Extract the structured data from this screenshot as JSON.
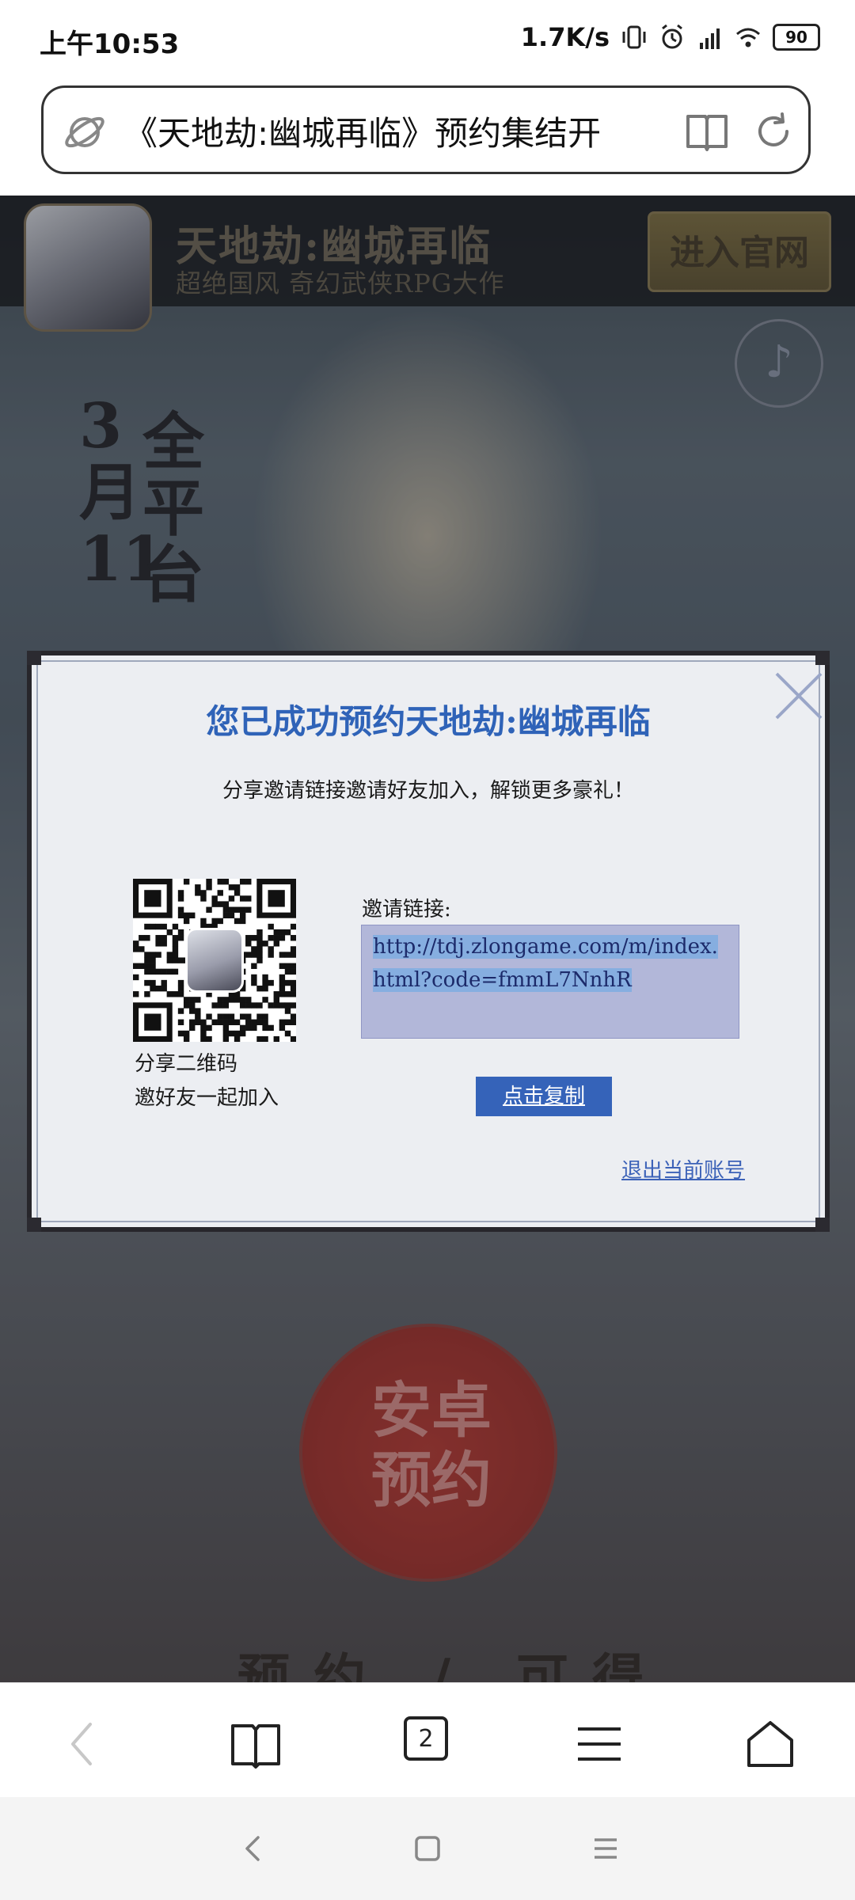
{
  "status_bar": {
    "time": "上午10:53",
    "network_speed": "1.7K/s",
    "battery": "90",
    "icons": [
      "vibrate-icon",
      "alarm-icon",
      "hd-signal-icon",
      "wifi-icon",
      "battery-icon"
    ]
  },
  "url_bar": {
    "text": "《天地劫:幽城再临》预约集结开",
    "icons": [
      "planet-icon",
      "reader-mode-icon",
      "reload-icon"
    ]
  },
  "page": {
    "banner": {
      "title": "天地劫:幽城再临",
      "subtitle": "超绝国风 奇幻武侠RPG大作",
      "enter_button": "进入官网"
    },
    "date_col1": "3月11",
    "date_col2": "全平台",
    "reserve_button": "安卓预约",
    "gift_text": "预约 / 可得"
  },
  "modal": {
    "title": "您已成功预约天地劫:幽城再临",
    "description": "分享邀请链接邀请好友加入，解锁更多豪礼！",
    "qr_label_line1": "分享二维码",
    "qr_label_line2": "邀好友一起加入",
    "invite_label": "邀请链接:",
    "invite_link": "http://tdj.zlongame.com/m/index.html?code=fmmL7NnhR",
    "copy_button": "点击复制",
    "logout_link": "退出当前账号"
  },
  "toolbar": {
    "tab_count": "2",
    "items": [
      "back-icon",
      "bookmarks-icon",
      "tabs-icon",
      "menu-icon",
      "home-icon"
    ]
  },
  "system_nav": [
    "system-back-icon",
    "system-home-icon",
    "system-recents-icon"
  ],
  "colors": {
    "modal_title": "#2f63b8",
    "copy_button": "#3563b9",
    "invite_box": "#b2b7d9",
    "reserve_circle": "#a22b25"
  }
}
